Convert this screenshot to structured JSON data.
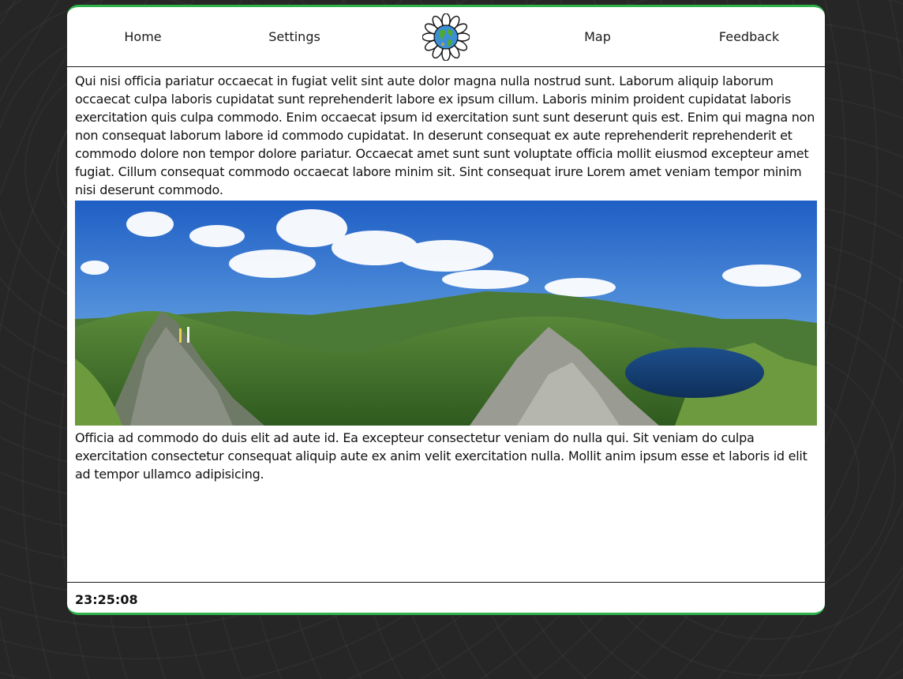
{
  "nav": {
    "items": [
      {
        "label": "Home"
      },
      {
        "label": "Settings"
      },
      {
        "label": "Map"
      },
      {
        "label": "Feedback"
      }
    ],
    "logo_icon": "globe-flower-logo-icon"
  },
  "content": {
    "paragraph_1": "Qui nisi officia pariatur occaecat in fugiat velit sint aute dolor magna nulla nostrud sunt. Laborum aliquip laborum occaecat culpa laboris cupidatat sunt reprehenderit labore ex ipsum cillum. Laboris minim proident cupidatat laboris exercitation quis culpa commodo. Enim occaecat ipsum id exercitation sunt sunt deserunt quis est. Enim qui magna non non consequat laborum labore id commodo cupidatat. In deserunt consequat ex aute reprehenderit reprehenderit et commodo dolore non tempor dolore pariatur. Occaecat amet sunt sunt voluptate officia mollit eiusmod excepteur amet fugiat. Cillum consequat commodo occaecat labore minim sit. Sint consequat irure Lorem amet veniam tempor minim nisi deserunt commodo.",
    "paragraph_2": "Officia ad commodo do duis elit ad aute id. Ea excepteur consectetur veniam do nulla qui. Sit veniam do culpa exercitation consectetur consequat aliquip aute ex anim velit exercitation nulla. Mollit anim ipsum esse et laboris id elit ad tempor ullamco adipisicing."
  },
  "footer": {
    "clock": "23:25:08"
  },
  "colors": {
    "accent": "#2db34a",
    "background": "#262626",
    "card": "#ffffff"
  }
}
